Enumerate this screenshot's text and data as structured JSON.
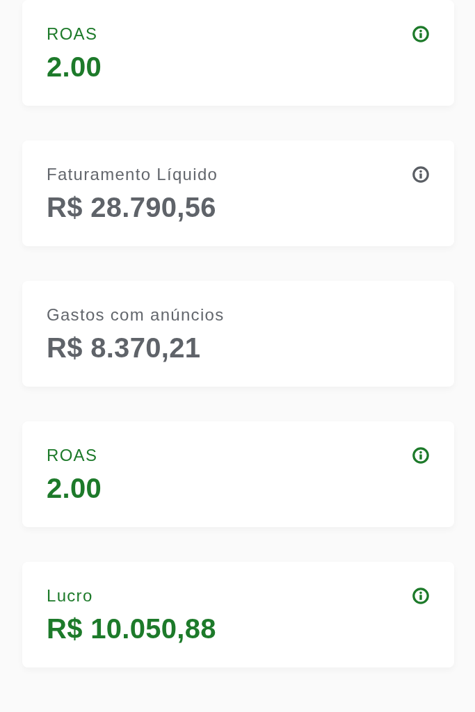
{
  "cards": [
    {
      "label": "ROAS",
      "value": "2.00",
      "highlighted": true,
      "info_icon": true
    },
    {
      "label": "Faturamento Líquido",
      "value": "R$ 28.790,56",
      "highlighted": false,
      "info_icon": true
    },
    {
      "label": "Gastos com anúncios",
      "value": "R$ 8.370,21",
      "highlighted": false,
      "info_icon": false
    },
    {
      "label": "ROAS",
      "value": "2.00",
      "highlighted": true,
      "info_icon": true
    },
    {
      "label": "Lucro",
      "value": "R$ 10.050,88",
      "highlighted": true,
      "info_icon": true
    }
  ]
}
